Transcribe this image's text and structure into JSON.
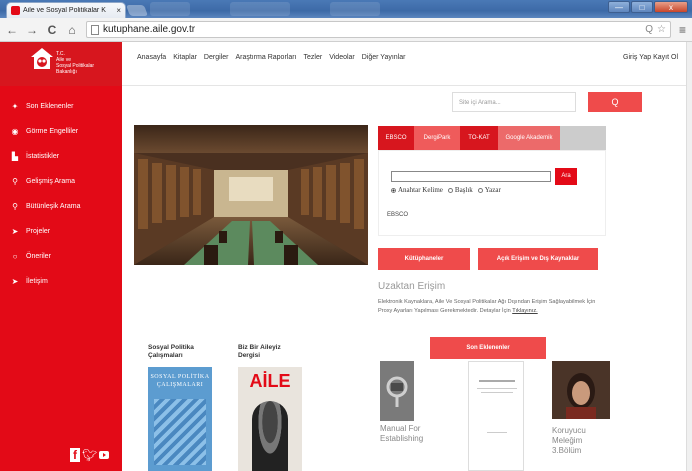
{
  "browser": {
    "tab_title": "Aile ve Sosyal Politikalar K",
    "tab_close": "×",
    "url": "kutuphane.aile.gov.tr",
    "back": "←",
    "forward": "→",
    "reload": "C",
    "home": "⌂",
    "zoom": "Q",
    "star": "☆",
    "menu": "≡",
    "window_buttons": [
      "—",
      "□",
      "x"
    ]
  },
  "logo": {
    "text_lines": [
      "T.C.",
      "Aile ve",
      "Sosyal Politikalar",
      "Bakanlığı"
    ]
  },
  "topnav": [
    "Anasayfa",
    "Kitaplar",
    "Dergiler",
    "Araştırma Raporları",
    "Tezler",
    "Videolar",
    "Diğer Yayınlar"
  ],
  "login": "Giriş Yap Kayıt Ol",
  "sidebar": [
    {
      "icon": "star-icon",
      "glyph": "✦",
      "label": "Son Eklenenler"
    },
    {
      "icon": "eye-icon",
      "glyph": "◉",
      "label": "Görme Engelliler"
    },
    {
      "icon": "chart-icon",
      "glyph": "▙",
      "label": "İstatistikler"
    },
    {
      "icon": "search-icon",
      "glyph": "⚲",
      "label": "Gelişmiş Arama"
    },
    {
      "icon": "search-icon",
      "glyph": "⚲",
      "label": "Bütünleşik Arama"
    },
    {
      "icon": "pushpin-icon",
      "glyph": "➤",
      "label": "Projeler"
    },
    {
      "icon": "speech-bubble-icon",
      "glyph": "○",
      "label": "Öneriler"
    },
    {
      "icon": "send-icon",
      "glyph": "➤",
      "label": "İletişim"
    }
  ],
  "search": {
    "placeholder": "Site içi Arama...",
    "button": "Q"
  },
  "db_tabs": [
    "EBSCO",
    "DergiPark",
    "TO-KAT",
    "Google Akademik"
  ],
  "ebsco": {
    "button": "Ara",
    "radios": [
      "Anahtar Kelime",
      "Başlık",
      "Yazar"
    ],
    "label": "EBSCO"
  },
  "buttons": {
    "libraries": "Kütüphaneler",
    "open_access": "Açık Erişim ve Dış Kaynaklar",
    "recent": "Son Eklenenler"
  },
  "remote": {
    "title": "Uzaktan Erişim",
    "text": "Elektronik Kaynaklara, Aile Ve Sosyal Politikalar Ağı Dışından Erişim Sağlayabilmek İçin Proxy Ayarları Yapılması Gerekmektedir. Detaylar İçin",
    "link": "Tıklayınız."
  },
  "publications": [
    {
      "title": "Sosyal Politika Çalışmaları",
      "cover_text": "SOSYAL POLİTİKA ÇALIŞMALARI"
    },
    {
      "title": "Biz Bir Aileyiz Dergisi",
      "cover_text": "AİLE"
    }
  ],
  "recent_items": [
    {
      "caption": "Manual For Establishing"
    },
    {
      "caption": ""
    },
    {
      "caption": "Koruyucu Meleğim 3.Bölüm"
    }
  ],
  "colors": {
    "brand": "#e30a17",
    "button": "#ef4b4b",
    "pink_tab": "#ec6a6a"
  }
}
